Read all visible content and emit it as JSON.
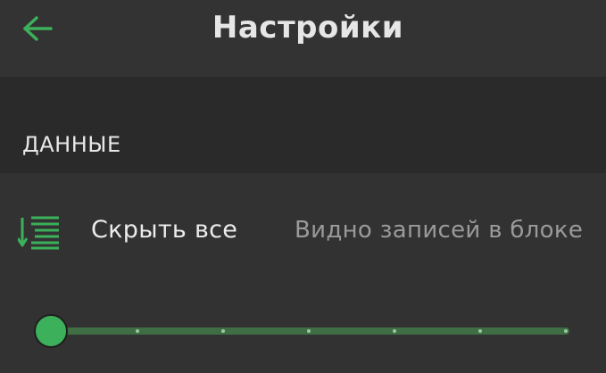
{
  "header": {
    "title": "Настройки",
    "back_icon": "arrow-left-icon"
  },
  "section": {
    "title": "ДАННЫЕ"
  },
  "row": {
    "icon": "sort-list-icon",
    "collapse_label": "Скрыть все",
    "visible_label": "Видно записей в блоке"
  },
  "slider": {
    "value_fraction": 0,
    "steps": 6
  },
  "colors": {
    "accent": "#3cb05a",
    "track": "#3f6e44",
    "background": "#303030"
  }
}
